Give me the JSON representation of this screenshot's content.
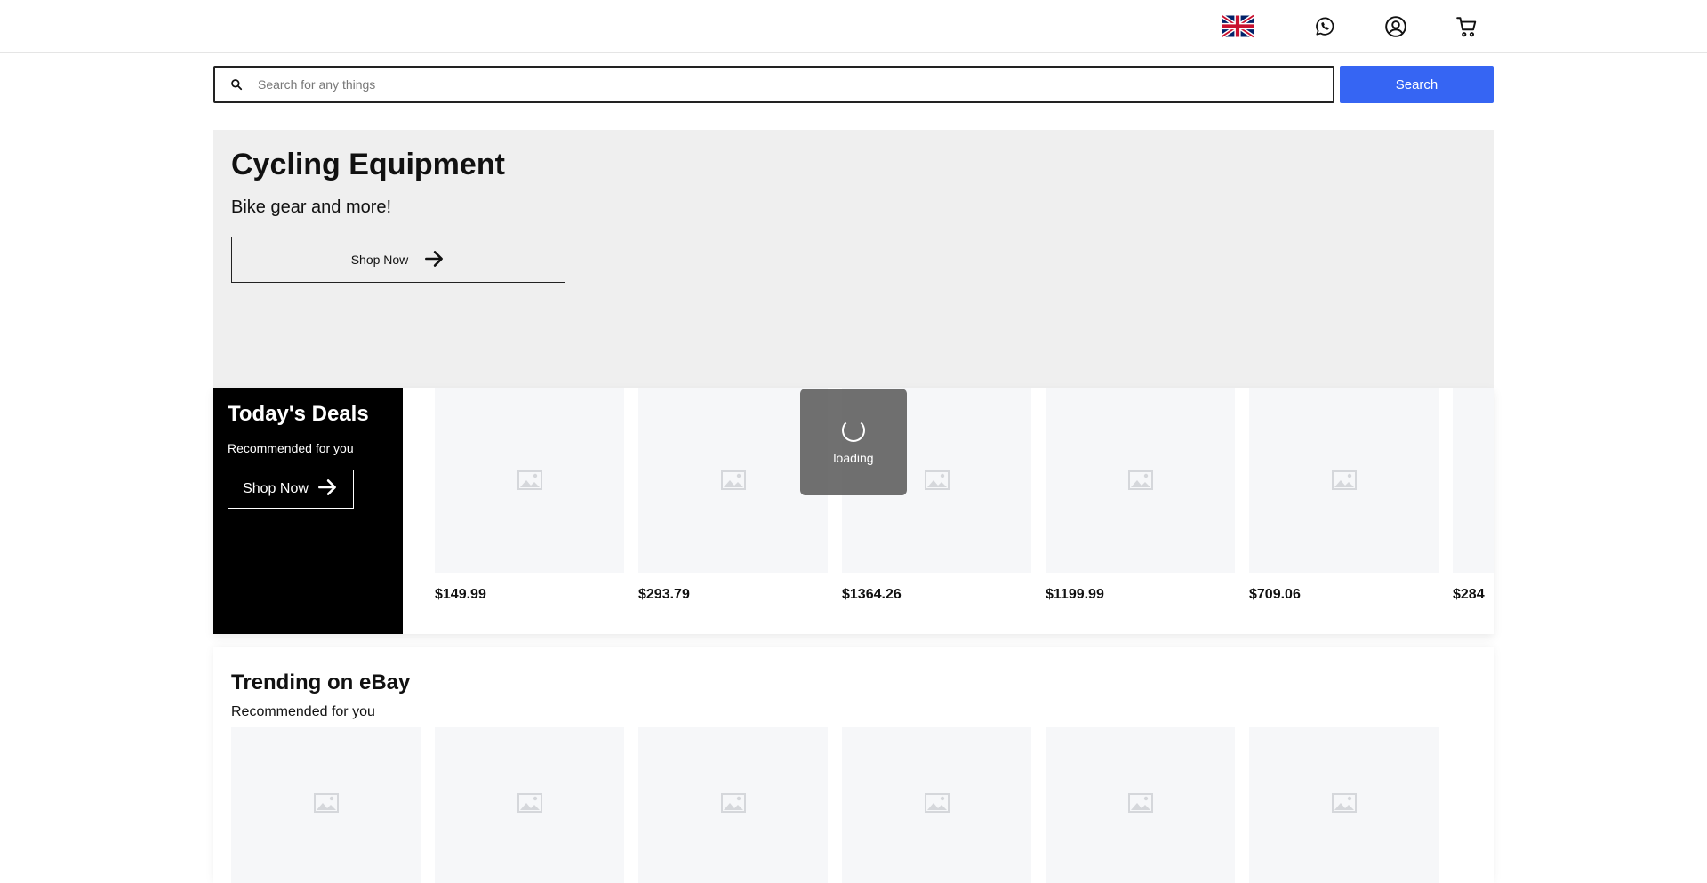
{
  "header": {
    "flag_icon": "uk-flag-icon",
    "icons": [
      "whatsapp-icon",
      "user-account-icon",
      "cart-icon"
    ]
  },
  "search": {
    "placeholder": "Search for any things",
    "value": "",
    "button_label": "Search",
    "accent_color": "#3665f3"
  },
  "hero": {
    "title": "Cycling Equipment",
    "subtitle": "Bike gear and more!",
    "button_label": "Shop Now"
  },
  "deals": {
    "title": "Today's Deals",
    "subtitle": "Recommended for you",
    "button_label": "Shop Now",
    "products": [
      {
        "price": "$149.99"
      },
      {
        "price": "$293.79"
      },
      {
        "price": "$1364.26"
      },
      {
        "price": "$1199.99"
      },
      {
        "price": "$709.06"
      },
      {
        "price": "$284"
      }
    ]
  },
  "loading": {
    "label": "loading"
  },
  "trending": {
    "title": "Trending on eBay",
    "subtitle": "Recommended for you"
  }
}
